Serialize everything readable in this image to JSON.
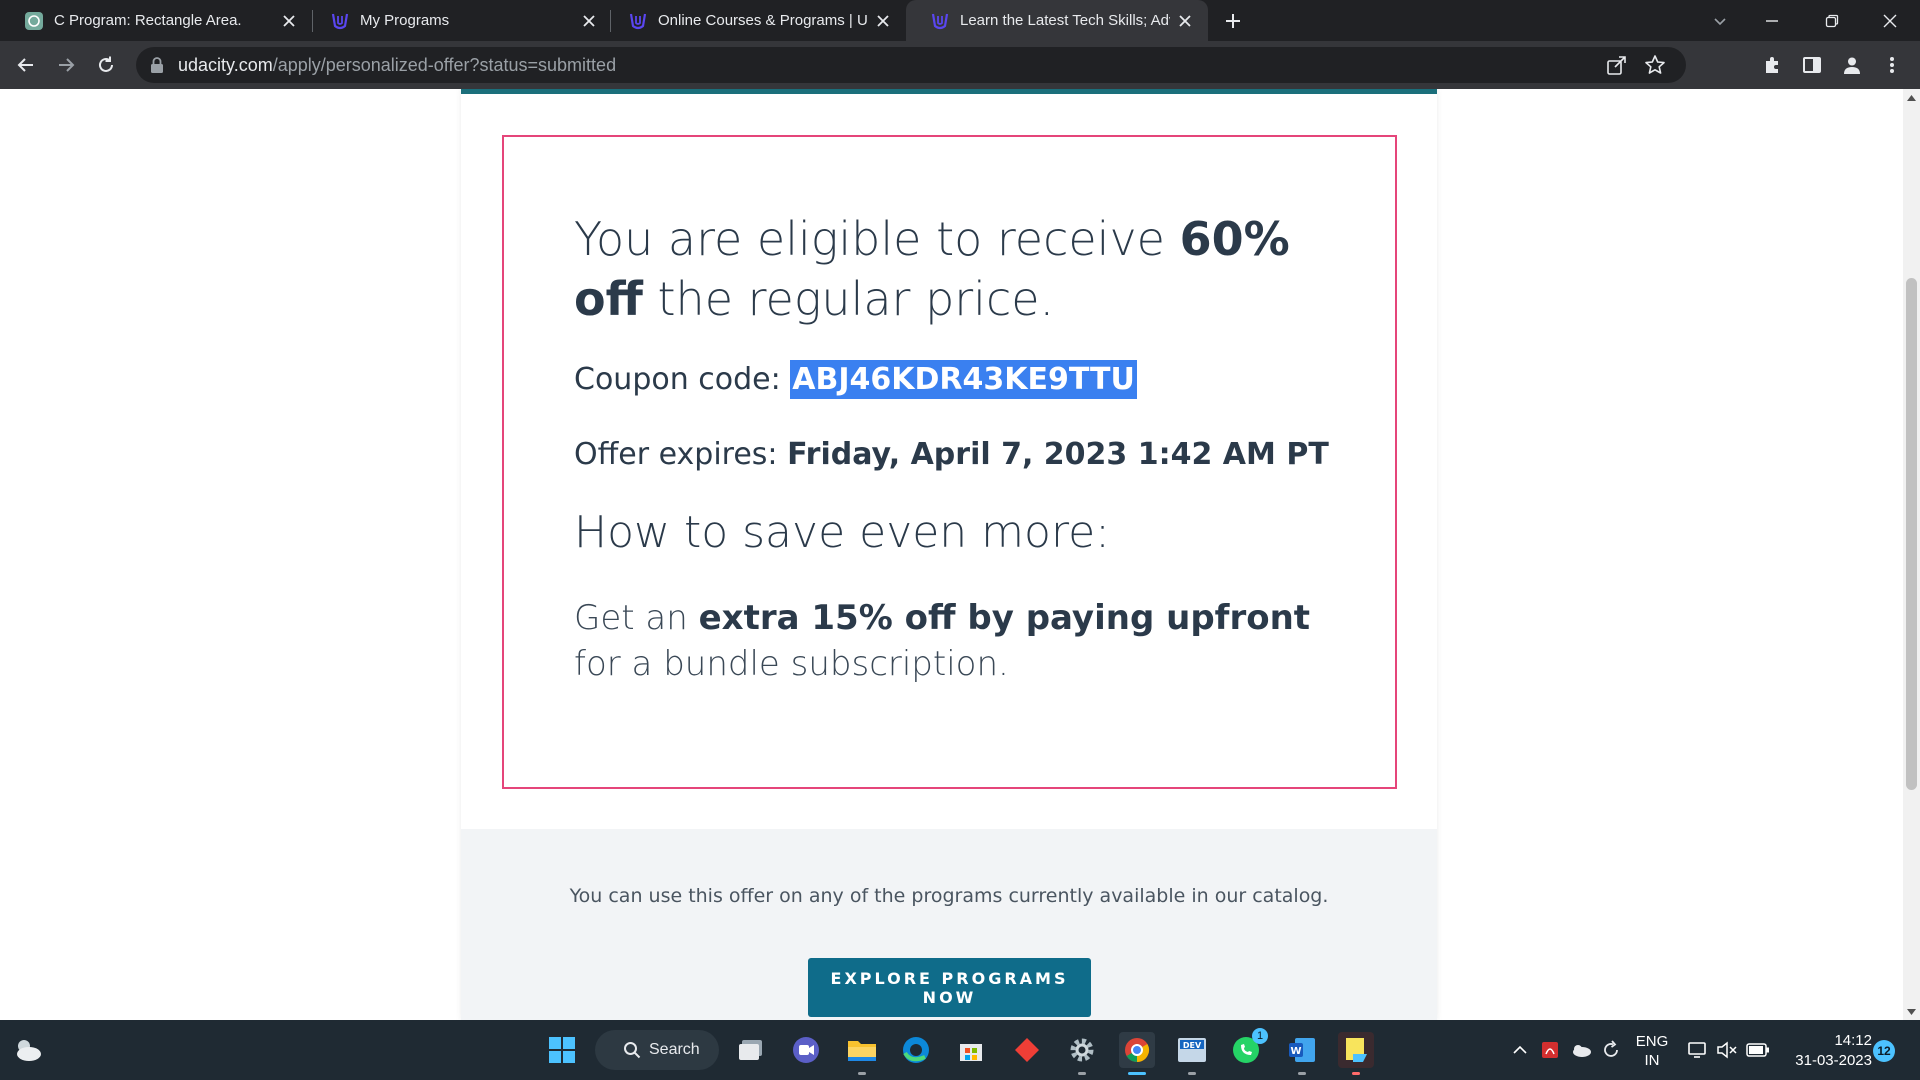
{
  "browser": {
    "tabs": [
      {
        "title": "C Program: Rectangle Area.",
        "favicon": "chatgpt-icon",
        "active": false
      },
      {
        "title": "My Programs",
        "favicon": "udacity-icon",
        "active": false
      },
      {
        "title": "Online Courses & Programs | Udacity",
        "favicon": "udacity-icon",
        "active": false
      },
      {
        "title": "Learn the Latest Tech Skills; Advance Your Career | Udacity",
        "favicon": "udacity-icon",
        "active": true
      }
    ],
    "address": {
      "host": "udacity.com",
      "path": "/apply/personalized-offer?status=submitted"
    }
  },
  "offer": {
    "headline_pre": "You are eligible to receive ",
    "headline_bold": "60% off",
    "headline_post": " the regular price.",
    "coupon_label": "Coupon code: ",
    "coupon_code": "ABJ46KDR43KE9TTU",
    "expires_label": "Offer expires: ",
    "expires_value": "Friday, April 7, 2023 1:42 AM PT",
    "save_heading": "How to save even more:",
    "tip_pre": "Get an ",
    "tip_bold": "extra 15% off by paying upfront",
    "tip_post": " for a bundle subscription."
  },
  "catalog": {
    "note": "You can use this offer on any of the programs currently available in our catalog.",
    "button_label": "EXPLORE PROGRAMS NOW"
  },
  "taskbar": {
    "search_label": "Search",
    "whatsapp_badge": "1",
    "lang_line1": "ENG",
    "lang_line2": "IN",
    "time": "14:12",
    "date": "31-03-2023",
    "notification_count": "12"
  },
  "colors": {
    "accent_pink": "#e5457a",
    "teal_button": "#0f6c8a",
    "selection_blue": "#3a80f0"
  }
}
